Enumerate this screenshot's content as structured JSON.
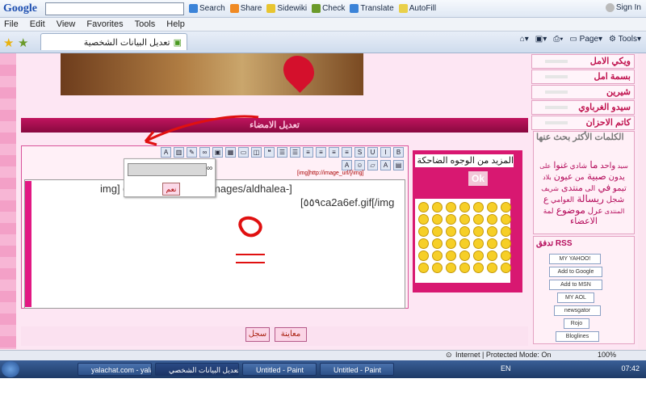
{
  "google_toolbar": {
    "logo": "Google",
    "items": [
      "Search",
      "Share",
      "Sidewiki",
      "Check",
      "Translate",
      "AutoFill"
    ],
    "sign_in": "Sign In"
  },
  "menu": {
    "items": [
      "File",
      "Edit",
      "View",
      "Favorites",
      "Tools",
      "Help"
    ]
  },
  "tab": {
    "title": "تعديل البيانات الشخصية"
  },
  "command_bar": {
    "page": "Page",
    "tools": "Tools"
  },
  "page": {
    "section_title": "تعديل الامضاء",
    "editor": {
      "image_hint": "[img]http://image_url/[/img]",
      "line1": "img]                    ea.net/up/uploads/images/aldhalea-]",
      "line2": "[٥٥٩ca2a6ef.gif[/img",
      "popup_ok": "نعم"
    },
    "smiley_panel": {
      "title": "المزيد من الوجوه الضاحكة",
      "ok": "Ok"
    },
    "buttons": {
      "preview": "معاينة",
      "save": "سجل"
    }
  },
  "right_nav": {
    "items": [
      "ويكي الامل",
      "بسمة امل",
      "شيرين",
      "سيدو الغرباوي",
      "كاتم الاحزان"
    ]
  },
  "keywords": {
    "title": "الكلمات الأكثر بحث عنها",
    "words": [
      "سيد",
      "واحد",
      "ما",
      "شادي",
      "غنوا",
      "على",
      "يدون",
      "صبية",
      "من",
      "عيون",
      "بلاد",
      "تيمو",
      "في",
      "الى",
      "منتدى",
      "شريف",
      "شجل",
      "ريسالة",
      "العوامي",
      "ع",
      "المنتدى",
      "عرل",
      "موضوع",
      "لمة",
      "الاعضاء"
    ]
  },
  "feeds": {
    "title": "تدفق RSS",
    "items": [
      "MY YAHOO!",
      "Add to Google",
      "Add to MSN",
      "MY AOL",
      "newsgator",
      "Rojo",
      "Bloglines"
    ]
  },
  "status": {
    "zone": "Internet | Protected Mode: On",
    "zoom": "100%"
  },
  "taskbar": {
    "tasks": [
      "yalachat.com - yala...",
      "تعديل البيانات الشخصي...",
      "Untitled - Paint",
      "Untitled - Paint"
    ],
    "lang": "EN",
    "time": "07:42"
  }
}
